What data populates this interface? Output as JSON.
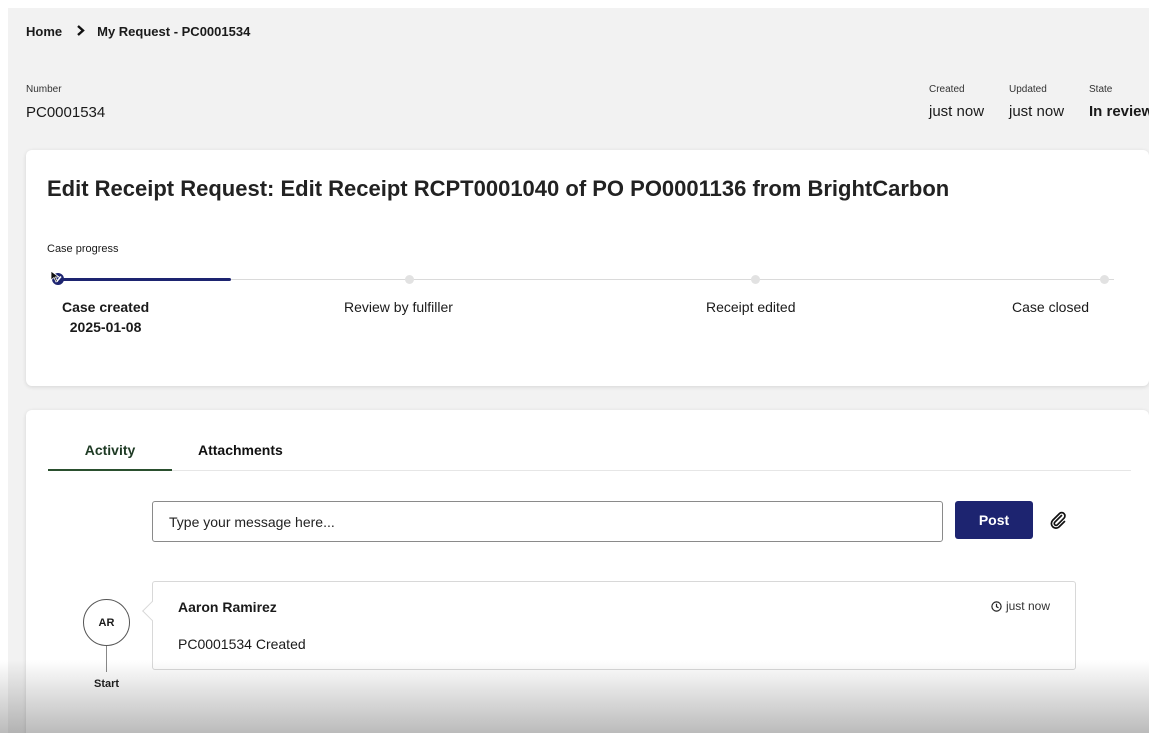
{
  "breadcrumb": {
    "home": "Home",
    "current": "My Request - PC0001534"
  },
  "meta": {
    "number_label": "Number",
    "number_value": "PC0001534",
    "created_label": "Created",
    "created_value": "just now",
    "updated_label": "Updated",
    "updated_value": "just now",
    "state_label": "State",
    "state_value": "In review"
  },
  "case": {
    "title": "Edit Receipt Request: Edit Receipt RCPT0001040 of PO PO0001136 from BrightCarbon",
    "progress_label": "Case progress",
    "steps": [
      {
        "name": "Case created",
        "date": "2025-01-08"
      },
      {
        "name": "Review by fulfiller"
      },
      {
        "name": "Receipt edited"
      },
      {
        "name": "Case closed"
      }
    ]
  },
  "activity": {
    "tabs": [
      "Activity",
      "Attachments"
    ],
    "message_placeholder": "Type your message here...",
    "post_label": "Post",
    "entries": [
      {
        "initials": "AR",
        "author": "Aaron Ramirez",
        "time": "just now",
        "text": "PC0001534 Created"
      }
    ],
    "timeline_start": "Start"
  },
  "colors": {
    "primary": "#1d2470",
    "tab_accent": "#2a4f2e",
    "page_bg": "#f2f2f2"
  }
}
